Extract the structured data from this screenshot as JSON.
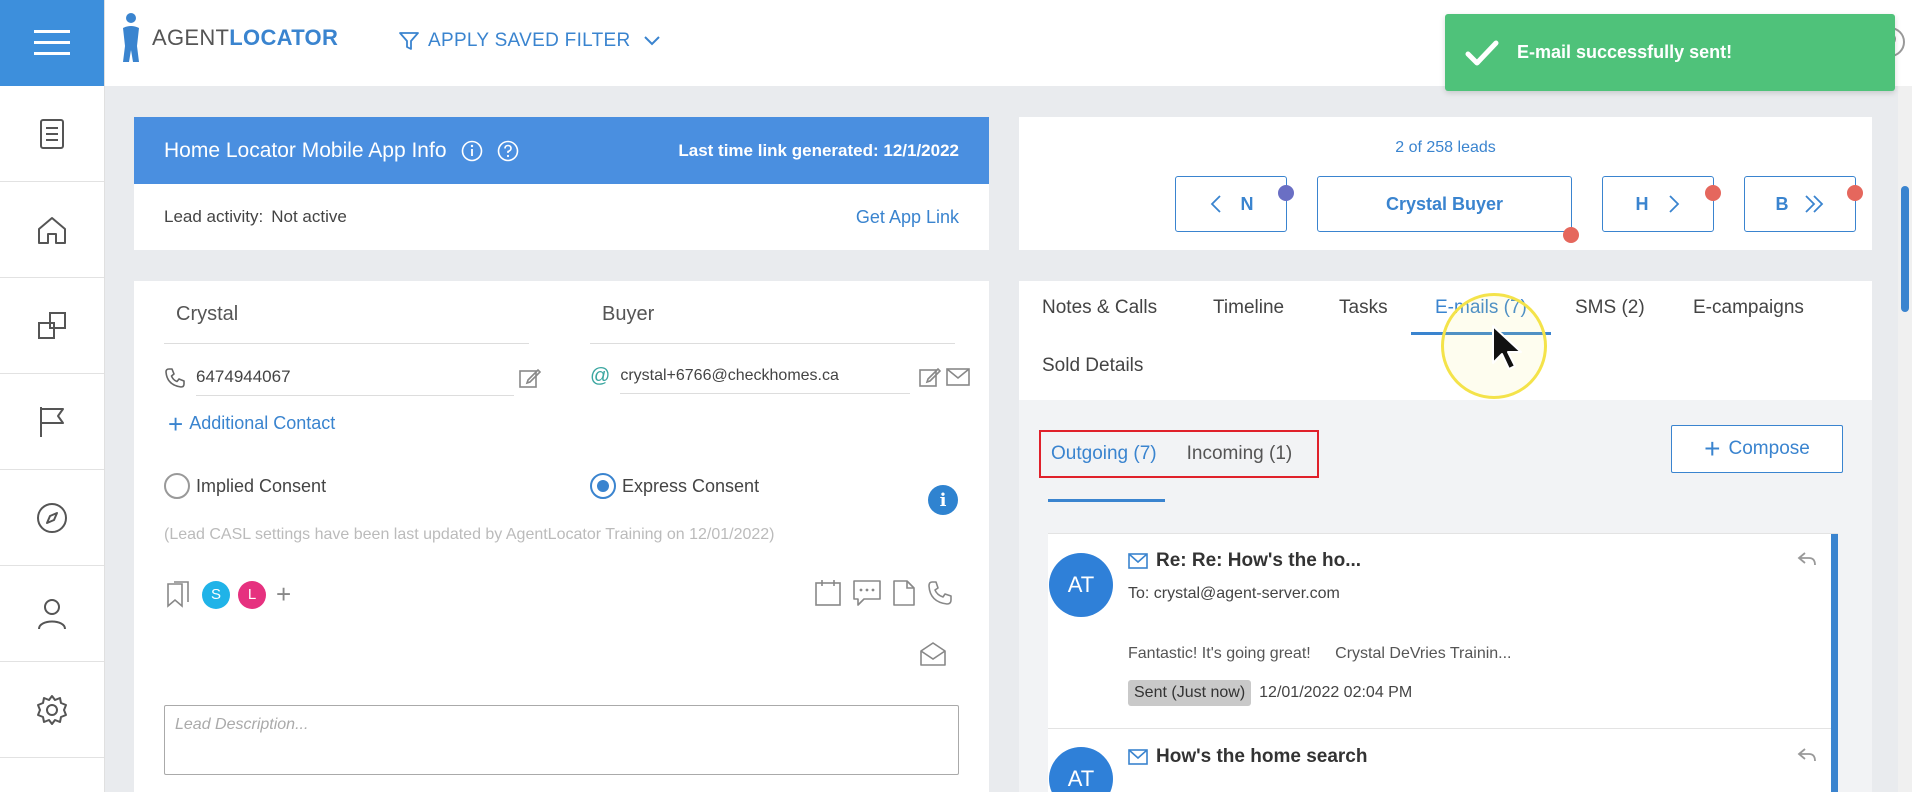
{
  "app": {
    "logo_agent": "AGENT",
    "logo_locator": "LOCATOR"
  },
  "topbar": {
    "saved_filter_label": "APPLY SAVED FILTER"
  },
  "toast": {
    "message": "E-mail successfully sent!"
  },
  "app_info": {
    "title": "Home Locator Mobile App Info",
    "last_link_label": "Last time link generated: 12/1/2022",
    "lead_activity_label": "Lead activity:",
    "lead_activity_value": "Not active",
    "get_link_label": "Get App Link"
  },
  "lead": {
    "first_name": "Crystal",
    "last_name": "Buyer",
    "phone": "6474944067",
    "email": "crystal+6766@checkhomes.ca",
    "additional_contact_label": "Additional Contact",
    "implied_consent_label": "Implied Consent",
    "express_consent_label": "Express Consent",
    "casl_note": "(Lead CASL settings have been last updated by AgentLocator Training on 12/01/2022)",
    "tags": [
      "S",
      "L"
    ],
    "description_placeholder": "Lead Description..."
  },
  "lead_nav": {
    "count": "2 of 258 leads",
    "prev_label": "N",
    "current_label": "Crystal Buyer",
    "next_label": "H",
    "last_label": "B"
  },
  "tabs": {
    "notes": "Notes & Calls",
    "timeline": "Timeline",
    "tasks": "Tasks",
    "emails": "E-mails (7)",
    "sms": "SMS (2)",
    "ecampaigns": "E-campaigns",
    "sold": "Sold Details"
  },
  "emails": {
    "outgoing_label": "Outgoing (7)",
    "incoming_label": "Incoming (1)",
    "compose_label": "Compose",
    "items": [
      {
        "initials": "AT",
        "subject": "Re: Re: How's the ho...",
        "to": "To: crystal@agent-server.com",
        "preview": "Fantastic! It's going great!",
        "signature": "Crystal DeVries Trainin...",
        "status": "Sent (Just now)",
        "datetime": "12/01/2022 02:04 PM"
      },
      {
        "initials": "AT",
        "subject": "How's the home search"
      }
    ]
  },
  "colors": {
    "accent": "#3a84cf",
    "header_blue": "#4a8fe0",
    "toast_green": "#4fc27a",
    "highlight_red": "#e0202a"
  }
}
